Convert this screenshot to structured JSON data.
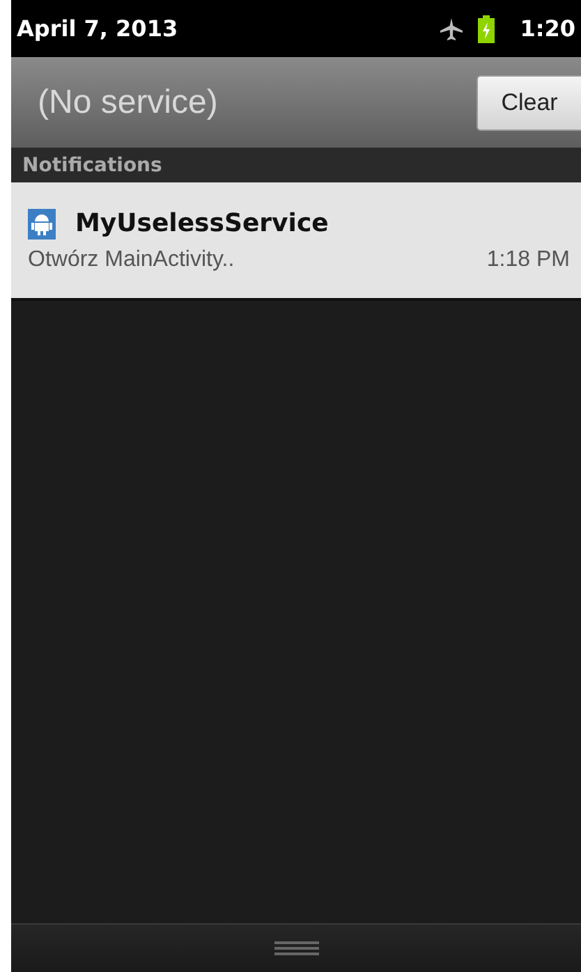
{
  "status_bar": {
    "date": "April 7, 2013",
    "time": "1:20"
  },
  "header": {
    "carrier": "(No service)",
    "clear_button": "Clear"
  },
  "section_title": "Notifications",
  "notifications": [
    {
      "title": "MyUselessService",
      "text": "Otwórz MainActivity..",
      "time": "1:18 PM"
    }
  ]
}
